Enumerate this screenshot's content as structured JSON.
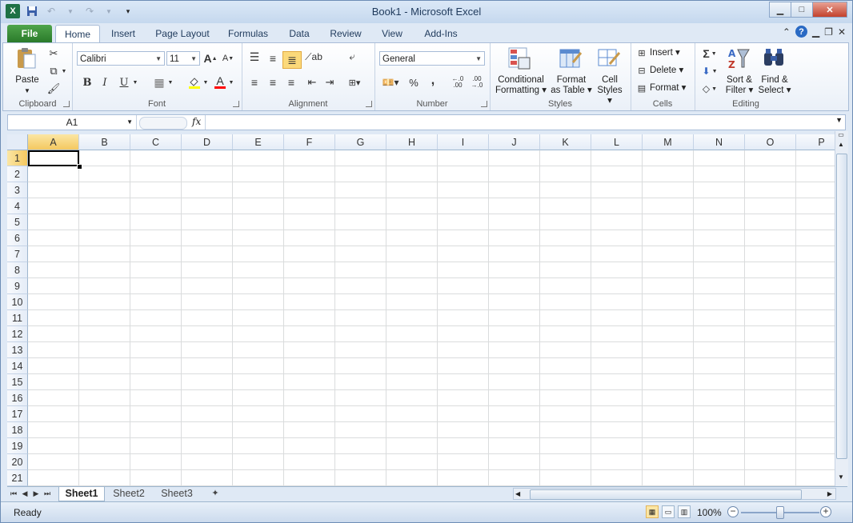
{
  "window": {
    "title": "Book1  -  Microsoft Excel"
  },
  "qat": {
    "app_icon": "X",
    "save_icon": "save-icon",
    "undo_icon": "undo-icon",
    "redo_icon": "redo-icon",
    "customize_icon": "customize-qat-icon"
  },
  "window_controls": {
    "minimize": "▁",
    "maximize": "□",
    "close": "✕"
  },
  "tabs": {
    "file": "File",
    "home": "Home",
    "insert": "Insert",
    "page_layout": "Page Layout",
    "formulas": "Formulas",
    "data": "Data",
    "review": "Review",
    "view": "View",
    "add_ins": "Add-Ins"
  },
  "ribbon": {
    "clipboard": {
      "label": "Clipboard",
      "paste": "Paste"
    },
    "font": {
      "label": "Font",
      "font_name": "Calibri",
      "font_size": "11",
      "bold": "B",
      "italic": "I",
      "underline": "U",
      "grow": "A",
      "shrink": "A",
      "font_color_glyph": "A"
    },
    "alignment": {
      "label": "Alignment"
    },
    "number": {
      "label": "Number",
      "format": "General",
      "percent": "%",
      "comma": ","
    },
    "styles": {
      "label": "Styles",
      "conditional_1": "Conditional",
      "conditional_2": "Formatting",
      "format_table_1": "Format",
      "format_table_2": "as Table",
      "cell_styles_1": "Cell",
      "cell_styles_2": "Styles"
    },
    "cells": {
      "label": "Cells",
      "insert": "Insert",
      "delete": "Delete",
      "format": "Format"
    },
    "editing": {
      "label": "Editing",
      "sum": "Σ",
      "sort_1": "Sort &",
      "sort_2": "Filter",
      "find_1": "Find &",
      "find_2": "Select"
    }
  },
  "formula_bar": {
    "name_box": "A1",
    "fx": "fx",
    "content": ""
  },
  "grid": {
    "columns": [
      "A",
      "B",
      "C",
      "D",
      "E",
      "F",
      "G",
      "H",
      "I",
      "J",
      "K",
      "L",
      "M",
      "N",
      "O",
      "P"
    ],
    "rows": [
      "1",
      "2",
      "3",
      "4",
      "5",
      "6",
      "7",
      "8",
      "9",
      "10",
      "11",
      "12",
      "13",
      "14",
      "15",
      "16",
      "17",
      "18",
      "19",
      "20",
      "21"
    ],
    "active_cell": "A1"
  },
  "sheets": {
    "sheet1": "Sheet1",
    "sheet2": "Sheet2",
    "sheet3": "Sheet3"
  },
  "status": {
    "text": "Ready",
    "zoom": "100%"
  },
  "colors": {
    "file_tab": "#2a7a2a",
    "selection_header": "#f4c860",
    "accent": "#1e395b"
  }
}
